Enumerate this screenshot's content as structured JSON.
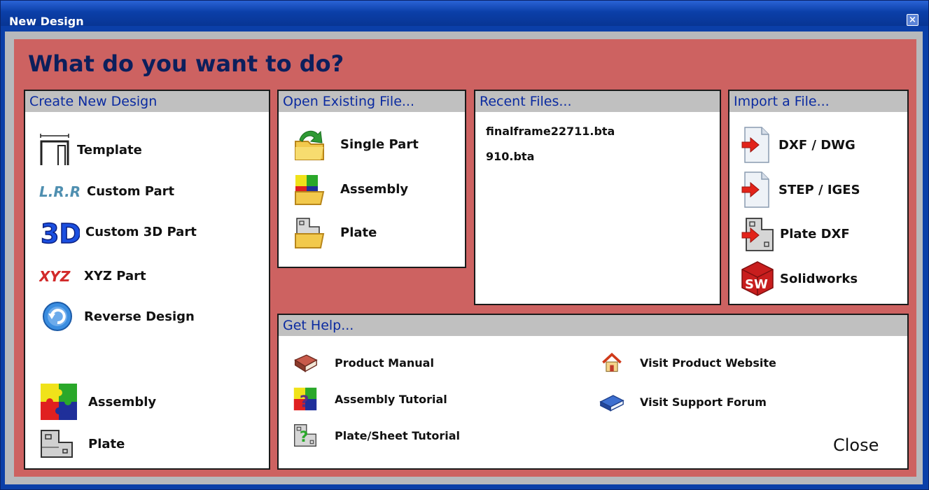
{
  "window": {
    "title": "New Design",
    "close_glyph": "×"
  },
  "heading": "What do you want to do?",
  "create": {
    "header": "Create New Design",
    "items": [
      {
        "label": "Template",
        "icon": "template-icon"
      },
      {
        "label": "Custom Part",
        "icon": "lra-icon"
      },
      {
        "label": "Custom 3D Part",
        "icon": "3d-icon"
      },
      {
        "label": "XYZ Part",
        "icon": "xyz-icon"
      },
      {
        "label": "Reverse Design",
        "icon": "reverse-icon"
      },
      {
        "label": "Assembly",
        "icon": "puzzle-icon"
      },
      {
        "label": "Plate",
        "icon": "plate-icon"
      }
    ],
    "lra_glyph": "L.R.R",
    "three_d_glyph": "3D",
    "xyz_glyph": "XYZ"
  },
  "open": {
    "header": "Open Existing File...",
    "items": [
      {
        "label": "Single Part",
        "icon": "folder-arrow-icon"
      },
      {
        "label": "Assembly",
        "icon": "folder-puzzle-icon"
      },
      {
        "label": "Plate",
        "icon": "folder-plate-icon"
      }
    ]
  },
  "recent": {
    "header": "Recent Files...",
    "files": [
      "finalframe22711.bta",
      "910.bta"
    ]
  },
  "import": {
    "header": "Import a File...",
    "items": [
      {
        "label": "DXF / DWG",
        "icon": "import-doc-icon"
      },
      {
        "label": "STEP / IGES",
        "icon": "import-doc-icon"
      },
      {
        "label": "Plate DXF",
        "icon": "import-plate-icon"
      },
      {
        "label": "Solidworks",
        "icon": "solidworks-icon"
      }
    ],
    "sw_glyph": "SW"
  },
  "help": {
    "header": "Get Help...",
    "items": [
      {
        "label": "Product Manual",
        "icon": "book-icon"
      },
      {
        "label": "Assembly Tutorial",
        "icon": "puzzle-question-icon"
      },
      {
        "label": "Plate/Sheet Tutorial",
        "icon": "plate-question-icon"
      },
      {
        "label": "Visit Product Website",
        "icon": "home-icon"
      },
      {
        "label": "Visit Support Forum",
        "icon": "forum-book-icon"
      }
    ],
    "question_glyph": "?",
    "close_label": "Close"
  },
  "colors": {
    "title_bar": "#0b3fa8",
    "background": "#cd6261",
    "panel_header": "#c0c0c0",
    "header_text": "#0a2aa0",
    "heading": "#0c1f5c"
  }
}
